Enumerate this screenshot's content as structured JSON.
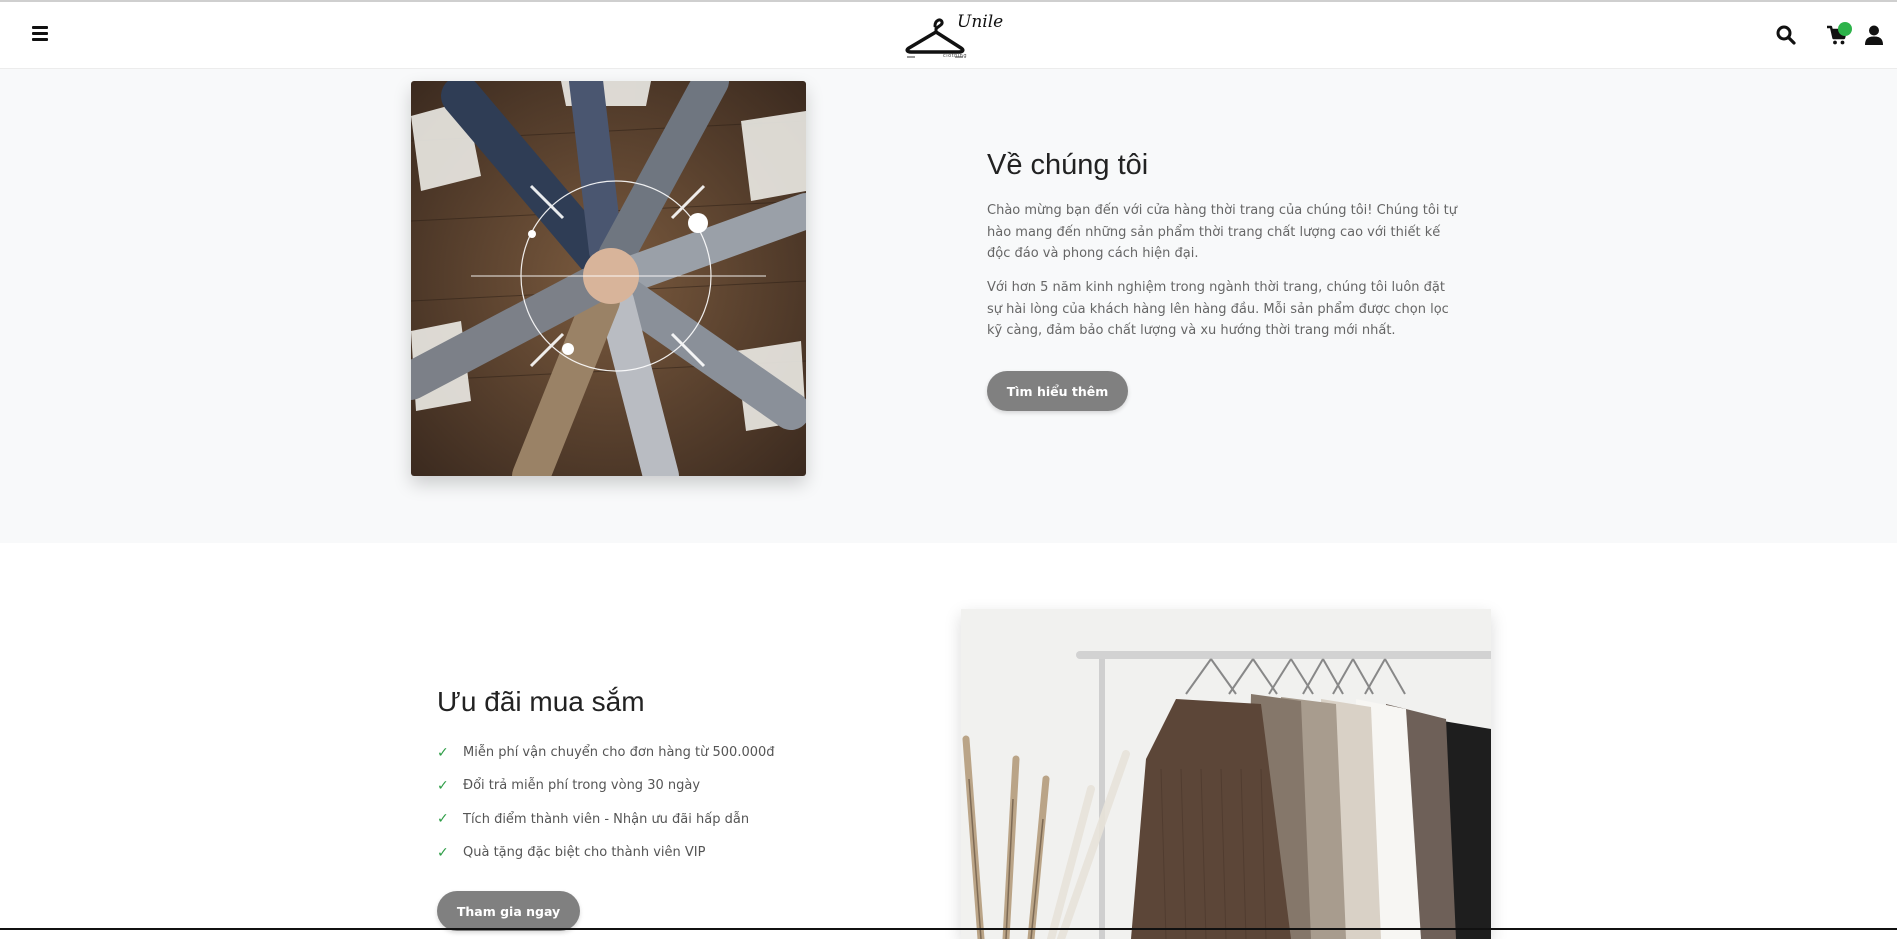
{
  "header": {
    "logo_text": "Unile",
    "logo_subtext": "clothing",
    "icons": [
      "menu-icon",
      "search-icon",
      "cart-icon",
      "user-icon"
    ],
    "cart_badge_color": "#2db34a"
  },
  "about": {
    "title": "Về chúng tôi",
    "paragraph_1": "Chào mừng bạn đến với cửa hàng thời trang của chúng tôi! Chúng tôi tự hào mang đến những sản phẩm thời trang chất lượng cao với thiết kế độc đáo và phong cách hiện đại.",
    "paragraph_2": "Với hơn 5 năm kinh nghiệm trong ngành thời trang, chúng tôi luôn đặt sự hài lòng của khách hàng lên hàng đầu. Mỗi sản phẩm được chọn lọc kỹ càng, đảm bảo chất lượng và xu hướng thời trang mới nhất.",
    "button_label": "Tìm hiểu thêm"
  },
  "offers": {
    "title": "Ưu đãi mua sắm",
    "items": [
      "Miễn phí vận chuyển cho đơn hàng từ 500.000đ",
      "Đổi trả miễn phí trong vòng 30 ngày",
      "Tích điểm thành viên - Nhận ưu đãi hấp dẫn",
      "Quà tặng đặc biệt cho thành viên VIP"
    ],
    "button_label": "Tham gia ngay"
  },
  "colors": {
    "button_bg": "#808080",
    "check": "#2e9d47",
    "section_bg": "#f8f9fa"
  }
}
